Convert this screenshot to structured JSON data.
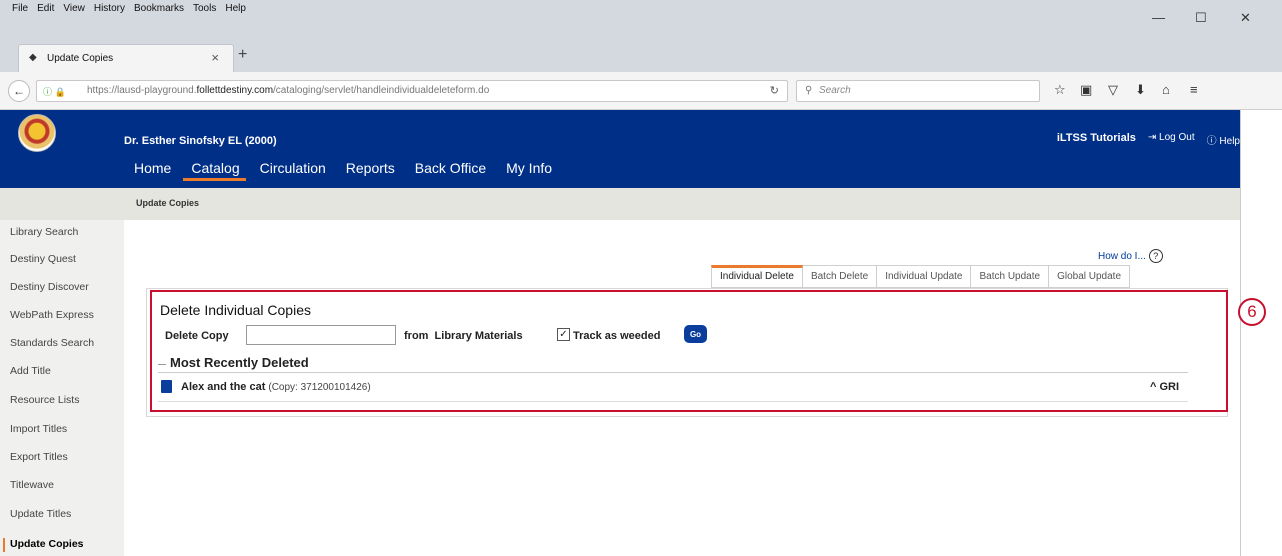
{
  "browser": {
    "menus": [
      "File",
      "Edit",
      "View",
      "History",
      "Bookmarks",
      "Tools",
      "Help"
    ],
    "tab_title": "Update Copies",
    "url_prefix": "https://lausd-playground.",
    "url_domain": "follettdestiny.com",
    "url_path": "/cataloging/servlet/handleindividualdeleteform.do",
    "search_placeholder": "Search"
  },
  "header": {
    "site_name": "Dr. Esther Sinofsky EL (2000)",
    "nav": [
      "Home",
      "Catalog",
      "Circulation",
      "Reports",
      "Back Office",
      "My Info"
    ],
    "active_nav": "Catalog",
    "tutorials": "iLTSS Tutorials",
    "logout": "Log Out",
    "help": "Help"
  },
  "breadcrumb": "Update Copies",
  "sidebar": {
    "items": [
      "Library Search",
      "Destiny Quest",
      "Destiny Discover",
      "WebPath Express",
      "Standards Search",
      "Add Title",
      "Resource Lists",
      "Import Titles",
      "Export Titles",
      "Titlewave",
      "Update Titles",
      "Update Copies"
    ],
    "active": "Update Copies"
  },
  "how_do_i": "How do I...",
  "how_do_i_icon": "?",
  "tabs": [
    "Individual Delete",
    "Batch Delete",
    "Individual Update",
    "Batch Update",
    "Global Update"
  ],
  "active_tab": "Individual Delete",
  "form": {
    "title": "Delete Individual Copies",
    "delete_copy_label": "Delete Copy",
    "delete_copy_value": "",
    "from_label": "from  Library Materials",
    "track_label": "Track as weeded",
    "track_checked": true,
    "go_label": "Go"
  },
  "recent": {
    "title": "Most Recently Deleted",
    "item_title": "Alex and the cat",
    "item_copy": "(Copy: 371200101426)",
    "call_number": "^ GRI"
  },
  "step_marker": "6",
  "colors": {
    "header_bg": "#002f87",
    "accent": "#e87b2c",
    "highlight": "#c8102e",
    "go_button": "#0a3d9c"
  }
}
